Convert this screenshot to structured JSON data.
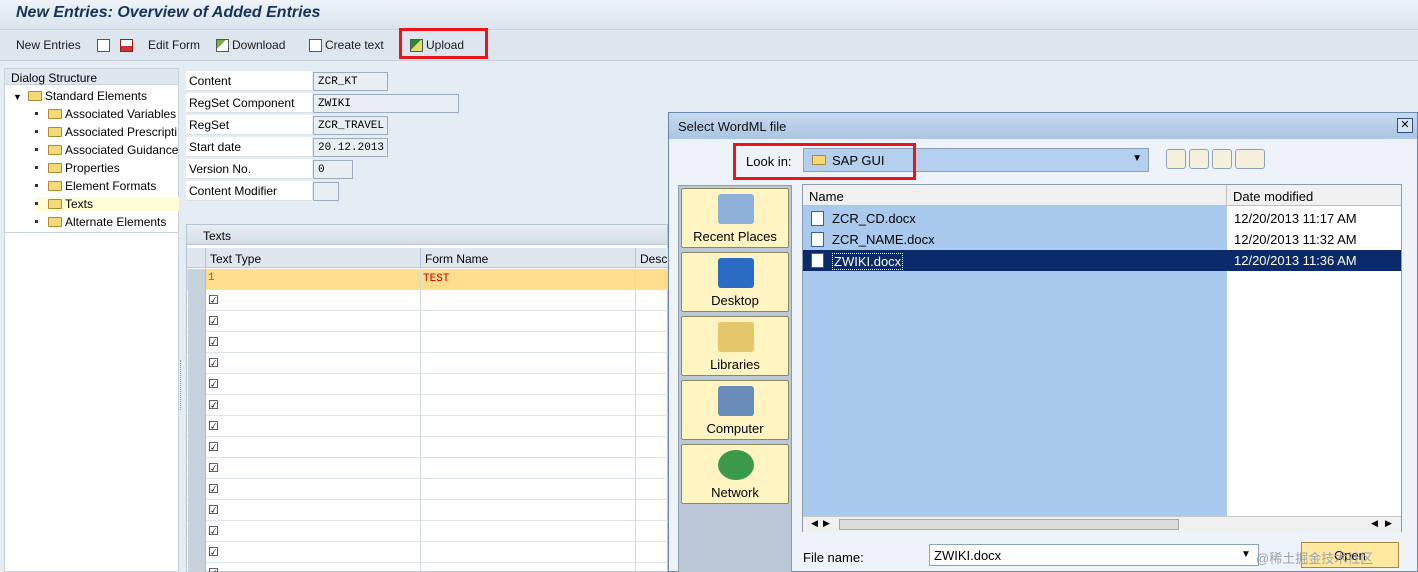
{
  "screen": {
    "title": "New Entries: Overview of Added Entries"
  },
  "toolbar": {
    "new_entries": "New Entries",
    "edit_form": "Edit Form",
    "download": "Download",
    "create_text": "Create text",
    "upload": "Upload"
  },
  "dialog_structure": {
    "header": "Dialog Structure",
    "root": "Standard Elements",
    "items": [
      "Associated Variables",
      "Associated Prescripti",
      "Associated Guidance",
      "Properties",
      "Element Formats",
      "Texts",
      "Alternate Elements"
    ],
    "selected": "Texts"
  },
  "fields": [
    {
      "label": "Content",
      "value": "ZCR_KT"
    },
    {
      "label": "RegSet Component",
      "value": "ZWIKI"
    },
    {
      "label": "RegSet",
      "value": "ZCR_TRAVEL"
    },
    {
      "label": "Start date",
      "value": "20.12.2013"
    },
    {
      "label": "Version No.",
      "value": "0"
    },
    {
      "label": "Content Modifier",
      "value": ""
    }
  ],
  "texts_table": {
    "title": "Texts",
    "columns": [
      "Text Type",
      "Form Name",
      "Descr"
    ],
    "first_row": {
      "text_type": "1",
      "form_name": "TEST"
    },
    "check_glyph": "☑"
  },
  "file_dialog": {
    "title": "Select WordML file",
    "close": "✕",
    "look_in_label": "Look in:",
    "look_in_value": "SAP GUI",
    "places": [
      "Recent Places",
      "Desktop",
      "Libraries",
      "Computer",
      "Network"
    ],
    "columns": [
      "Name",
      "Date modified"
    ],
    "files": [
      {
        "name": "ZCR_CD.docx",
        "date": "12/20/2013 11:17 AM"
      },
      {
        "name": "ZCR_NAME.docx",
        "date": "12/20/2013 11:32 AM"
      },
      {
        "name": "ZWIKI.docx",
        "date": "12/20/2013 11:36 AM"
      }
    ],
    "selected_file": "ZWIKI.docx",
    "file_name_label": "File name:",
    "file_name_value": "ZWIKI.docx",
    "open_button": "Open"
  },
  "watermark": "@稀土掘金技术社区",
  "colors": {
    "highlight_box": "#e8151b",
    "selected_row": "#0a2a6a",
    "places_bg": "#fff4c2"
  }
}
